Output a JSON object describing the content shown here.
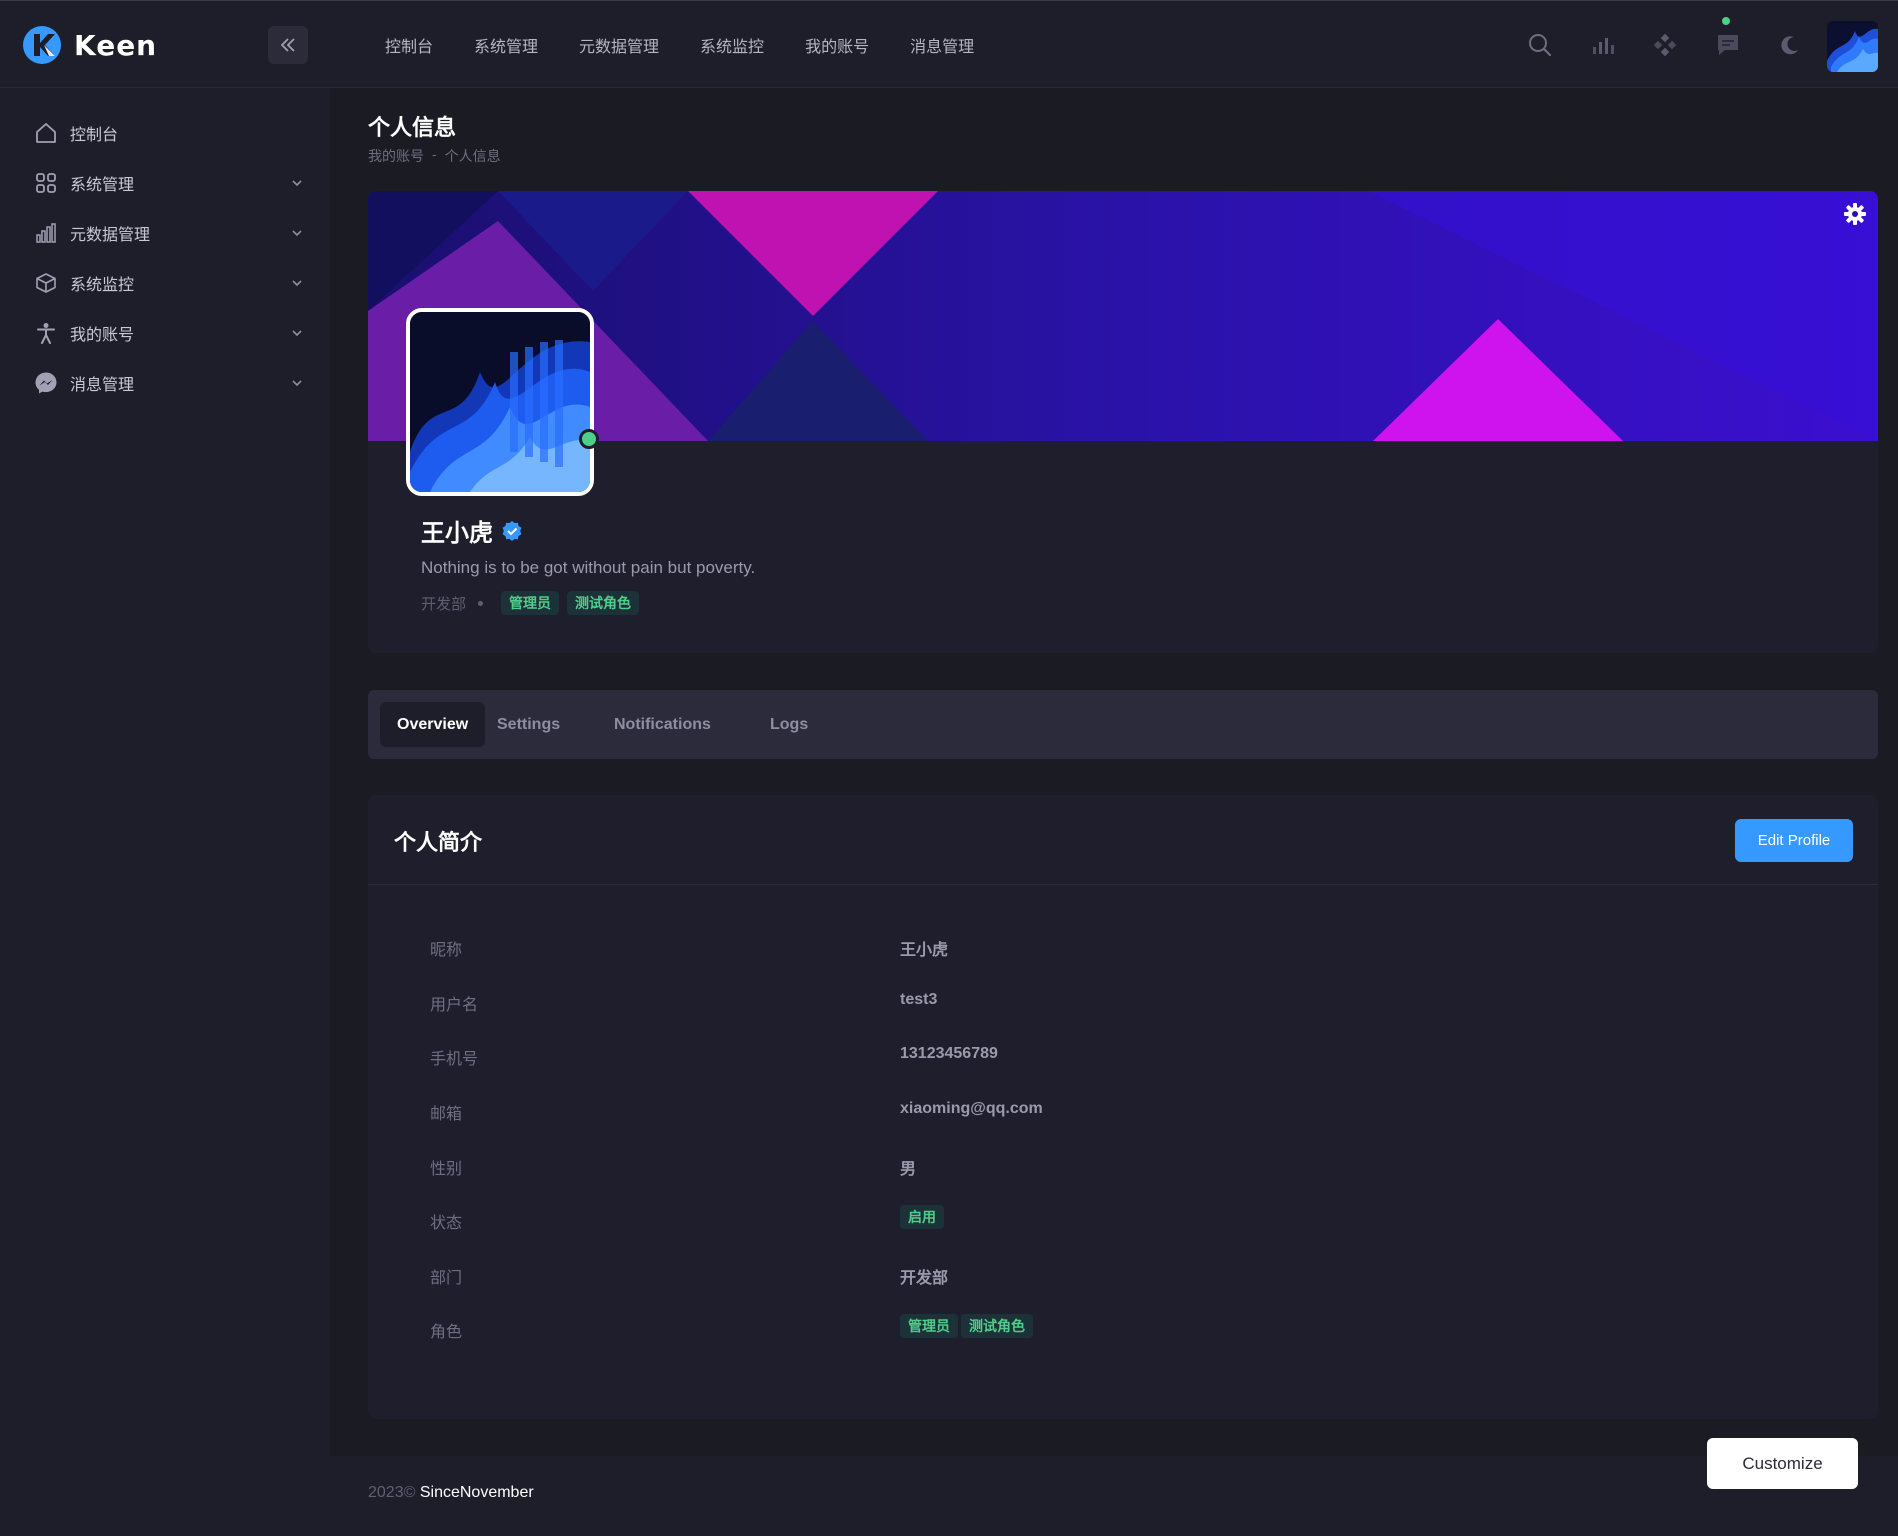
{
  "app": {
    "name": "Keen"
  },
  "topnav": {
    "items": [
      "控制台",
      "系统管理",
      "元数据管理",
      "系统监控",
      "我的账号",
      "消息管理"
    ]
  },
  "toolbar": {
    "icons": [
      "search-icon",
      "chart-bars-icon",
      "apps-icon",
      "message-icon",
      "moon-icon"
    ]
  },
  "sidebar": {
    "items": [
      {
        "label": "控制台",
        "icon": "home-icon",
        "expandable": false
      },
      {
        "label": "系统管理",
        "icon": "grid-icon",
        "expandable": true
      },
      {
        "label": "元数据管理",
        "icon": "bar-chart-icon",
        "expandable": true
      },
      {
        "label": "系统监控",
        "icon": "cube-icon",
        "expandable": true
      },
      {
        "label": "我的账号",
        "icon": "person-icon",
        "expandable": true
      },
      {
        "label": "消息管理",
        "icon": "messenger-icon",
        "expandable": true
      }
    ]
  },
  "page": {
    "title": "个人信息",
    "breadcrumb": [
      "我的账号",
      "-",
      "个人信息"
    ]
  },
  "profile": {
    "name": "王小虎",
    "bio": "Nothing is to be got without pain but poverty.",
    "department": "开发部",
    "roles": [
      "管理员",
      "测试角色"
    ]
  },
  "tabs": [
    "Overview",
    "Settings",
    "Notifications",
    "Logs"
  ],
  "details": {
    "title": "个人简介",
    "edit_label": "Edit Profile",
    "rows": [
      {
        "label": "昵称",
        "value": "王小虎"
      },
      {
        "label": "用户名",
        "value": "test3"
      },
      {
        "label": "手机号",
        "value": "13123456789"
      },
      {
        "label": "邮箱",
        "value": "xiaoming@qq.com"
      },
      {
        "label": "性别",
        "value": "男"
      },
      {
        "label": "状态",
        "value": "启用"
      },
      {
        "label": "部门",
        "value": "开发部"
      },
      {
        "label": "角色",
        "roles": [
          "管理员",
          "测试角色"
        ]
      }
    ]
  },
  "footer": {
    "year": "2023©",
    "link": "SinceNovember"
  },
  "customize_label": "Customize",
  "colors": {
    "accent": "#3699ff",
    "success": "#50cd89",
    "background": "#1b1b24",
    "panel": "#1e1e2d"
  }
}
